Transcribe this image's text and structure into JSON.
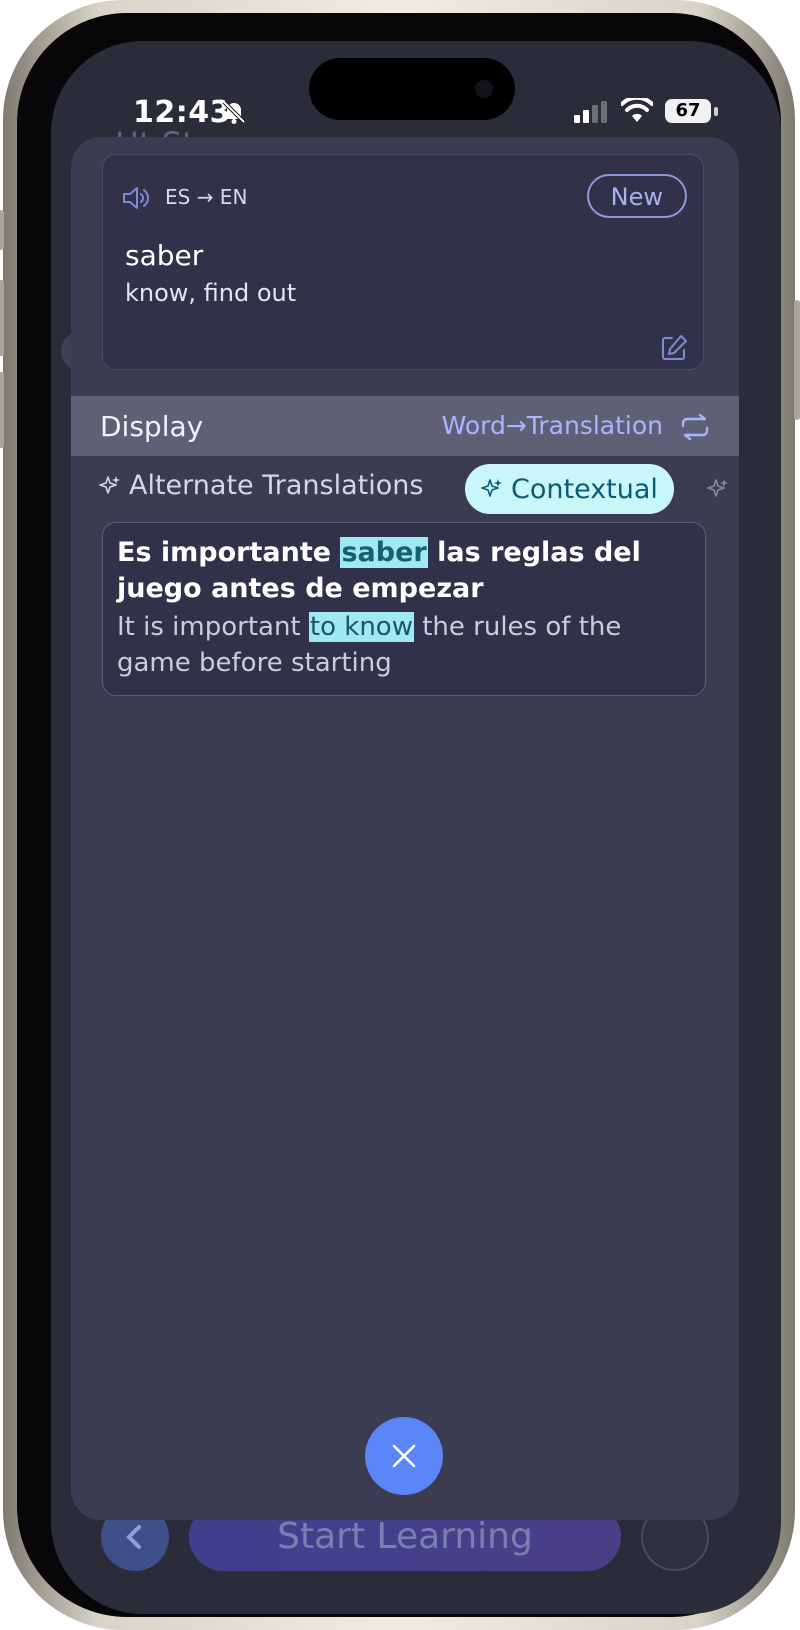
{
  "status_bar": {
    "time": "12:43",
    "battery": "67"
  },
  "background": {
    "title": "Ht St",
    "start_label": "Start Learning"
  },
  "word_card": {
    "lang_pair": "ES → EN",
    "new_label": "New",
    "word": "saber",
    "translation": "know, find out"
  },
  "display": {
    "label": "Display",
    "mode": "Word→Translation"
  },
  "tabs": {
    "alternate": "Alternate Translations",
    "contextual": "Contextual"
  },
  "context": {
    "es_before": "Es importante ",
    "es_highlight": "saber",
    "es_after": " las reglas del juego antes de empezar",
    "en_before": "It is important ",
    "en_highlight": "to know",
    "en_after": " the rules of the game before starting"
  },
  "colors": {
    "accent": "#5b86f7",
    "highlight": "#9fe9f3",
    "sheet": "#3b3b52",
    "card": "#31324a"
  }
}
